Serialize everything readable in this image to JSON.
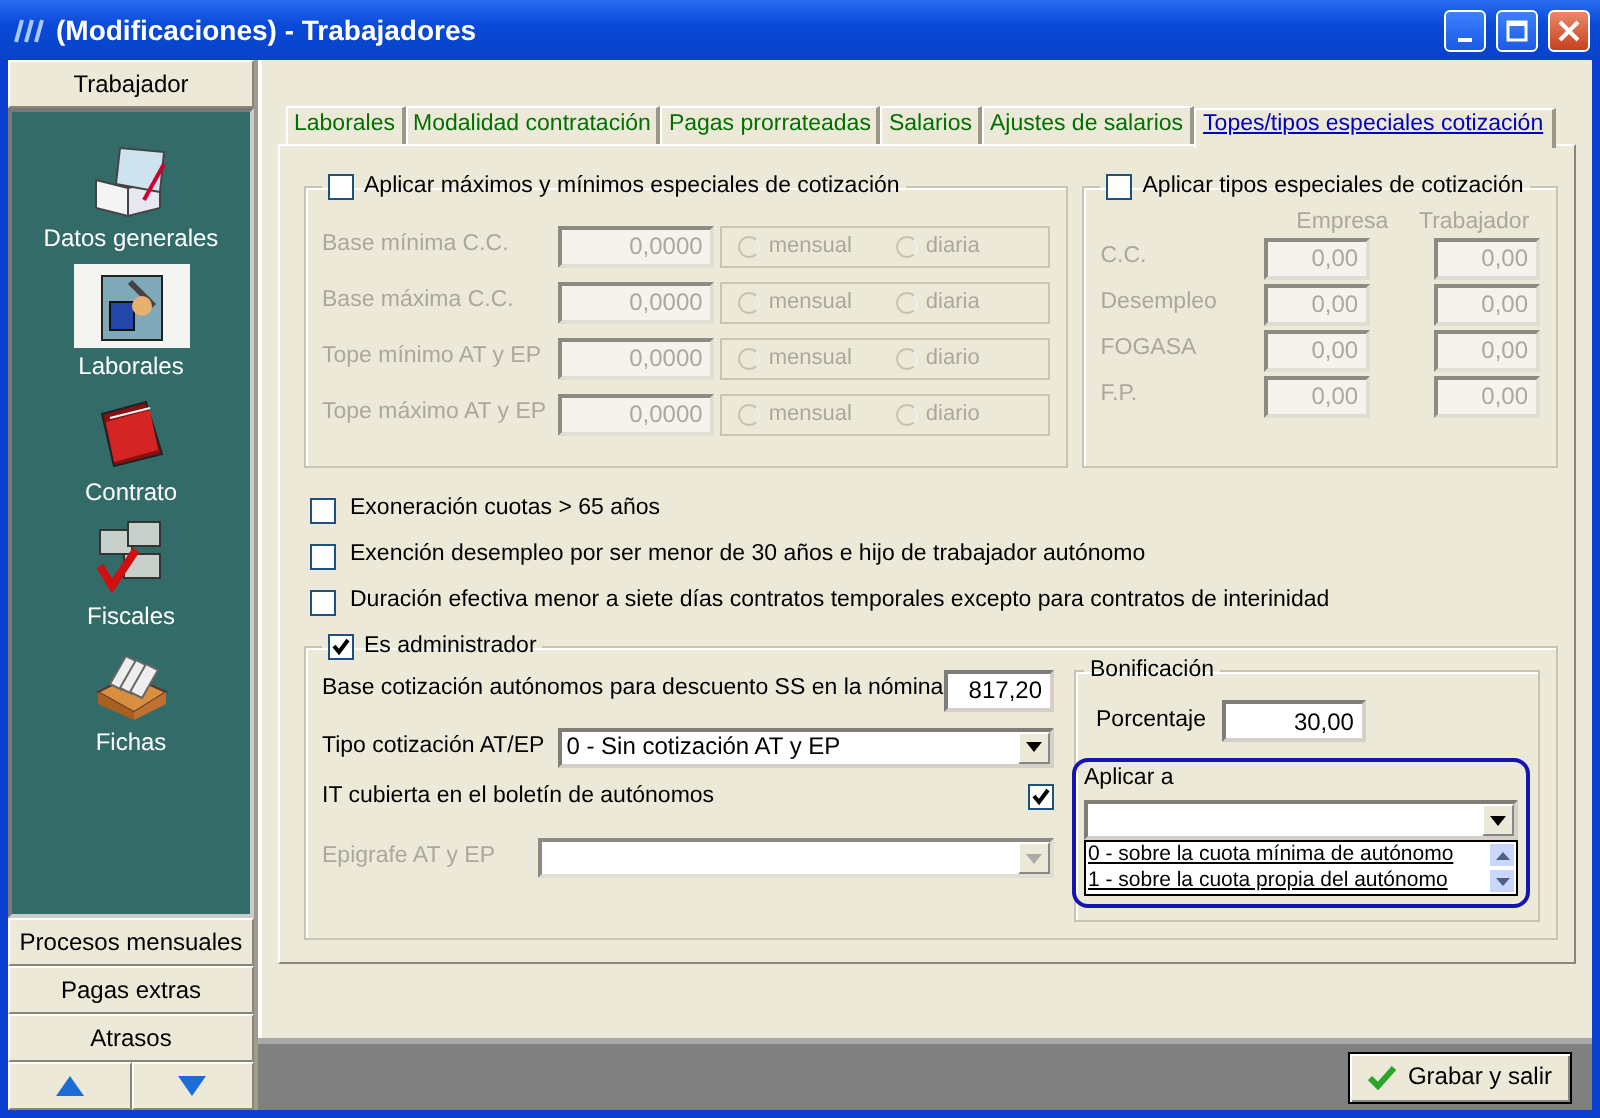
{
  "window": {
    "title": "(Modificaciones) - Trabajadores"
  },
  "sidebar": {
    "header": "Trabajador",
    "items": [
      {
        "label": "Datos generales",
        "kind": "book",
        "selected": false
      },
      {
        "label": "Laborales",
        "kind": "tools",
        "selected": true
      },
      {
        "label": "Contrato",
        "kind": "folder",
        "selected": false
      },
      {
        "label": "Fiscales",
        "kind": "calculator",
        "selected": false
      },
      {
        "label": "Fichas",
        "kind": "cards",
        "selected": false
      }
    ],
    "sections": [
      "Procesos mensuales",
      "Pagas extras",
      "Atrasos"
    ]
  },
  "tabs": [
    {
      "label": "Laborales",
      "selected": false
    },
    {
      "label": "Modalidad contratación",
      "selected": false
    },
    {
      "label": "Pagas prorrateadas",
      "selected": false
    },
    {
      "label": "Salarios",
      "selected": false
    },
    {
      "label": "Ajustes de salarios",
      "selected": false
    },
    {
      "label": "Topes/tipos especiales cotización",
      "selected": true
    }
  ],
  "topes": {
    "label": "Aplicar máximos y mínimos especiales de cotización",
    "checked": false,
    "rows": [
      {
        "label": "Base mínima C.C.",
        "value": "0,0000",
        "options": [
          {
            "label": "mensual",
            "selected": false
          },
          {
            "label": "diaria",
            "selected": false
          }
        ]
      },
      {
        "label": "Base máxima C.C.",
        "value": "0,0000",
        "options": [
          {
            "label": "mensual",
            "selected": false
          },
          {
            "label": "diaria",
            "selected": false
          }
        ]
      },
      {
        "label": "Tope mínimo AT y EP",
        "value": "0,0000",
        "options": [
          {
            "label": "mensual",
            "selected": false
          },
          {
            "label": "diario",
            "selected": false
          }
        ]
      },
      {
        "label": "Tope máximo AT y EP",
        "value": "0,0000",
        "options": [
          {
            "label": "mensual",
            "selected": false
          },
          {
            "label": "diario",
            "selected": false
          }
        ]
      }
    ]
  },
  "tipos": {
    "label": "Aplicar tipos especiales de cotización",
    "checked": false,
    "columns": [
      "Empresa",
      "Trabajador"
    ],
    "rows": [
      {
        "label": "C.C.",
        "empresa": "0,00",
        "trabajador": "0,00"
      },
      {
        "label": "Desempleo",
        "empresa": "0,00",
        "trabajador": "0,00"
      },
      {
        "label": "FOGASA",
        "empresa": "0,00",
        "trabajador": "0,00"
      },
      {
        "label": "F.P.",
        "empresa": "0,00",
        "trabajador": "0,00"
      }
    ]
  },
  "options": [
    {
      "label": "Exoneración cuotas > 65 años",
      "checked": false
    },
    {
      "label": "Exención desempleo por ser menor de 30 años e hijo de trabajador autónomo",
      "checked": false
    },
    {
      "label": "Duración efectiva menor a siete días contratos temporales excepto para contratos de interinidad",
      "checked": false
    }
  ],
  "administrador": {
    "label": "Es administrador",
    "checked": true,
    "base": {
      "label": "Base cotización autónomos para descuento SS en la nómina",
      "value": "817,20"
    },
    "tipo": {
      "label": "Tipo cotización AT/EP",
      "value": "0 - Sin cotización AT y EP"
    },
    "it": {
      "label": "IT cubierta en el boletín de autónomos",
      "checked": true
    },
    "epigrafe": {
      "label": "Epigrafe AT y EP",
      "disabled": true
    },
    "bonificacion": {
      "label": "Bonificación",
      "porcentaje": {
        "label": "Porcentaje",
        "value": "30,00"
      },
      "aplicar": {
        "label": "Aplicar a",
        "focused": true,
        "options": [
          {
            "label": "0 - sobre la cuota mínima de autónomo",
            "selected": false
          },
          {
            "label": "1 - sobre la cuota propia del autónomo",
            "selected": false
          }
        ]
      }
    }
  },
  "save_button": "Grabar y salir"
}
